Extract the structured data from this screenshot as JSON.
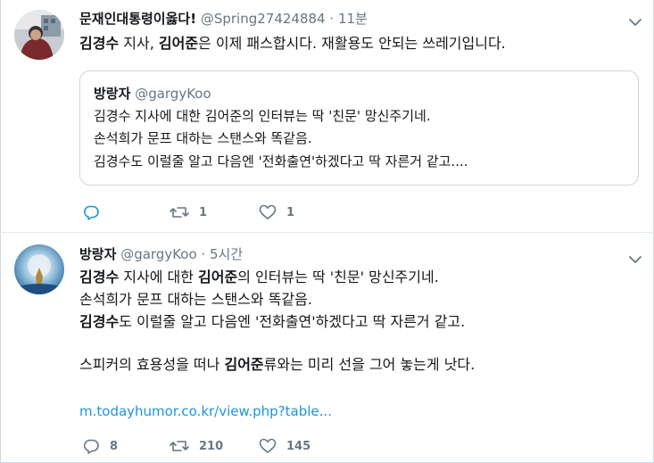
{
  "tweet1": {
    "display_name": "문재인대통령이옳다!",
    "handle": "@Spring27424884",
    "dot": "·",
    "time": "11분",
    "text_parts": [
      "김경수",
      " 지사, ",
      "김어준",
      "은 이제 패스합시다. 재활용도 안되는 쓰레기입니다."
    ],
    "quote": {
      "display_name": "방랑자",
      "handle": "@garg yKoo",
      "lines": [
        "김경수 지사에 대한 김어준의 인터뷰는 딱 '친문' 망신주기네.",
        "손석희가 문프 대하는 스탠스와 똑같음.",
        "김경수도 이럴줄 알고 다음엔 '전화출연'하겠다고 딱 자른거 같고...."
      ]
    },
    "actions": {
      "reply_count": "",
      "retweet_count": "1",
      "like_count": "1"
    }
  },
  "tweet2": {
    "display_name": "방랑자",
    "handle": "@gargyKoo",
    "dot": "·",
    "time": "5시간",
    "line1": [
      "김경수",
      " 지사에 대한 ",
      "김어준",
      "의 인터뷰는 딱 '친문' 망신주기네."
    ],
    "line2": "손석희가 문프 대하는 스탠스와 똑같음.",
    "line3": [
      "김경수",
      "도 이럴줄 알고 다음엔 '전화출연'하겠다고 딱 자른거 같고."
    ],
    "line4": [
      "스피커의 효용성을 떠나 ",
      "김어준",
      "류와는 미리 선을 그어 놓는게 낫다."
    ],
    "link": "m.todayhumor.co.kr/view.php?table...",
    "actions": {
      "reply_count": "8",
      "retweet_count": "210",
      "like_count": "145"
    }
  },
  "colors": {
    "link": "#1b95e0",
    "meta": "#657786",
    "border": "#e6ecf0"
  },
  "icons": [
    "more-caret-icon",
    "reply-icon",
    "retweet-icon",
    "like-icon"
  ]
}
